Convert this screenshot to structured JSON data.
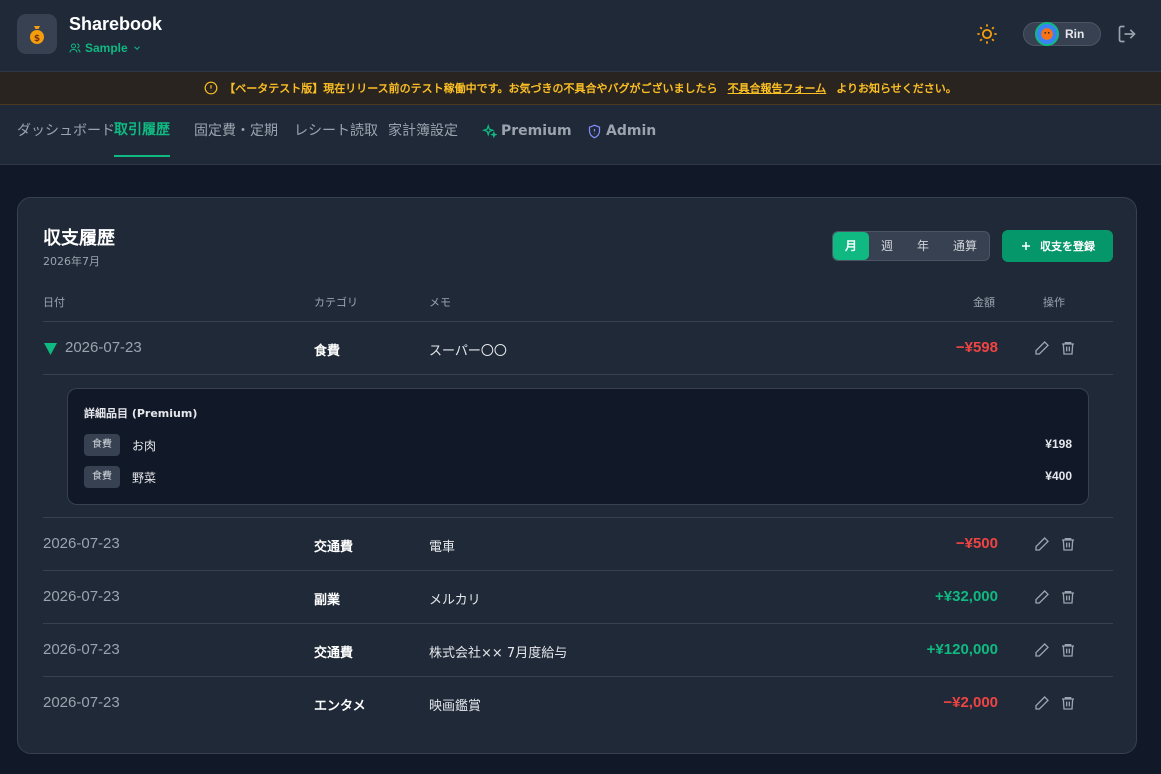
{
  "app": {
    "title": "Sharebook",
    "book_name": "Sample"
  },
  "user": {
    "name": "Rin"
  },
  "banner": {
    "text_before": "【ベータテスト版】現在リリース前のテスト稼働中です。お気づきの不具合やバグがございましたら",
    "link_text": "不具合報告フォーム",
    "text_after": "よりお知らせください。"
  },
  "nav": {
    "items": [
      {
        "label": "ダッシュボード"
      },
      {
        "label": "取引履歴"
      },
      {
        "label": "固定費・定期"
      },
      {
        "label": "レシート読取"
      },
      {
        "label": "家計簿設定"
      },
      {
        "label": "Premium"
      },
      {
        "label": "Admin"
      }
    ]
  },
  "history": {
    "title": "収支履歴",
    "subtitle": "2026年7月",
    "periods": [
      "月",
      "週",
      "年",
      "通算"
    ],
    "add_label": "収支を登録",
    "columns": {
      "date": "日付",
      "category": "カテゴリ",
      "memo": "メモ",
      "amount": "金額",
      "actions": "操作"
    },
    "rows": [
      {
        "date": "2026-07-23",
        "category": "食費",
        "memo": "スーパー〇〇",
        "amount": "−¥598"
      },
      {
        "date": "2026-07-23",
        "category": "交通費",
        "memo": "電車",
        "amount": "−¥500"
      },
      {
        "date": "2026-07-23",
        "category": "副業",
        "memo": "メルカリ",
        "amount": "+¥32,000"
      },
      {
        "date": "2026-07-23",
        "category": "交通費",
        "memo": "株式会社×× 7月度給与",
        "amount": "+¥120,000"
      },
      {
        "date": "2026-07-23",
        "category": "エンタメ",
        "memo": "映画鑑賞",
        "amount": "−¥2,000"
      }
    ],
    "detail": {
      "title": "詳細品目 (Premium)",
      "items": [
        {
          "tag": "食費",
          "name": "お肉",
          "amount": "¥198"
        },
        {
          "tag": "食費",
          "name": "野菜",
          "amount": "¥400"
        }
      ]
    }
  },
  "colors": {
    "accent": "#10b981",
    "negative": "#ef4444",
    "warning": "#fbbf24",
    "admin": "#818cf8"
  }
}
